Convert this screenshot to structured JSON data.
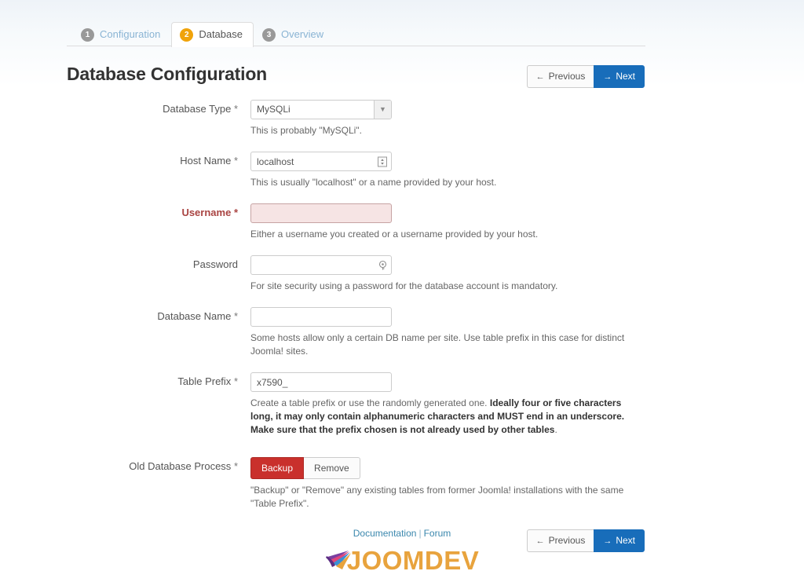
{
  "tabs": [
    {
      "num": "1",
      "label": "Configuration",
      "active": false
    },
    {
      "num": "2",
      "label": "Database",
      "active": true
    },
    {
      "num": "3",
      "label": "Overview",
      "active": false
    }
  ],
  "header": {
    "title": "Database Configuration",
    "previous_label": "Previous",
    "next_label": "Next",
    "prev_arrow": "←",
    "next_arrow": "→"
  },
  "form": {
    "database_type": {
      "label": "Database Type",
      "required": "*",
      "value": "MySQLi",
      "help": "This is probably \"MySQLi\"."
    },
    "host_name": {
      "label": "Host Name",
      "required": "*",
      "value": "localhost",
      "placeholder": "",
      "help": "This is usually \"localhost\" or a name provided by your host."
    },
    "username": {
      "label": "Username",
      "required": "*",
      "value": "",
      "placeholder": "",
      "help": "Either a username you created or a username provided by your host.",
      "state": "error"
    },
    "password": {
      "label": "Password",
      "required": "",
      "value": "",
      "placeholder": "",
      "help": "For site security using a password for the database account is mandatory."
    },
    "database_name": {
      "label": "Database Name",
      "required": "*",
      "value": "",
      "placeholder": "",
      "help": "Some hosts allow only a certain DB name per site. Use table prefix in this case for distinct Joomla! sites."
    },
    "table_prefix": {
      "label": "Table Prefix",
      "required": "*",
      "value": "x7590_",
      "placeholder": "",
      "help_normal_1": "Create a table prefix or use the randomly generated one. ",
      "help_bold": "Ideally four or five characters long, it may only contain alphanumeric characters and MUST end in an underscore. Make sure that the prefix chosen is not already used by other tables",
      "help_normal_2": "."
    },
    "old_database_process": {
      "label": "Old Database Process",
      "required": "*",
      "options": [
        {
          "label": "Backup",
          "active": true
        },
        {
          "label": "Remove",
          "active": false
        }
      ],
      "help": "\"Backup\" or \"Remove\" any existing tables from former Joomla! installations with the same \"Table Prefix\"."
    }
  },
  "footer": {
    "documentation_label": "Documentation",
    "separator": "|",
    "forum_label": "Forum",
    "logo_text": "JOOMDEV"
  },
  "colors": {
    "accent_blue": "#186dba",
    "active_badge_orange": "#f0a30a",
    "error_red": "#a94442",
    "backup_red": "#c9302c",
    "logo_orange": "#e8a33d",
    "link_blue": "#3a87ad"
  }
}
